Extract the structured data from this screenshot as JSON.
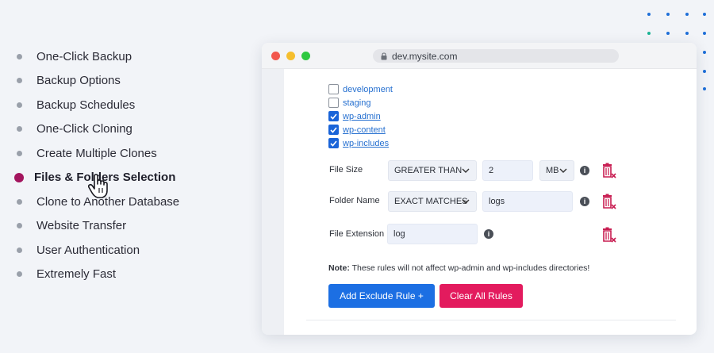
{
  "features": [
    {
      "label": "One-Click Backup",
      "active": false
    },
    {
      "label": "Backup Options",
      "active": false
    },
    {
      "label": "Backup Schedules",
      "active": false
    },
    {
      "label": "One-Click Cloning",
      "active": false
    },
    {
      "label": "Create Multiple Clones",
      "active": false
    },
    {
      "label": "Files & Folders Selection",
      "active": true
    },
    {
      "label": "Clone to Another Database",
      "active": false
    },
    {
      "label": "Website Transfer",
      "active": false
    },
    {
      "label": "User Authentication",
      "active": false
    },
    {
      "label": "Extremely Fast",
      "active": false
    }
  ],
  "browser": {
    "url": "dev.mysite.com"
  },
  "folders": [
    {
      "name": "development",
      "checked": false
    },
    {
      "name": "staging",
      "checked": false
    },
    {
      "name": "wp-admin",
      "checked": true
    },
    {
      "name": "wp-content",
      "checked": true
    },
    {
      "name": "wp-includes",
      "checked": true
    }
  ],
  "rules": {
    "file_size": {
      "label": "File Size",
      "operator": "GREATER THAN",
      "value": "2",
      "unit": "MB"
    },
    "folder_name": {
      "label": "Folder Name",
      "operator": "EXACT MATCHES",
      "value": "logs"
    },
    "file_extension": {
      "label": "File Extension",
      "value": "log"
    }
  },
  "note": {
    "prefix": "Note:",
    "text": " These rules will not affect wp-admin and wp-includes directories!"
  },
  "buttons": {
    "add_rule": "Add Exclude Rule +",
    "clear_rules": "Clear All Rules"
  },
  "colors": {
    "accent_blue": "#1c6fe3",
    "accent_pink": "#e31b5e",
    "active_bullet": "#a3155e",
    "trash_red": "#c81e52"
  }
}
